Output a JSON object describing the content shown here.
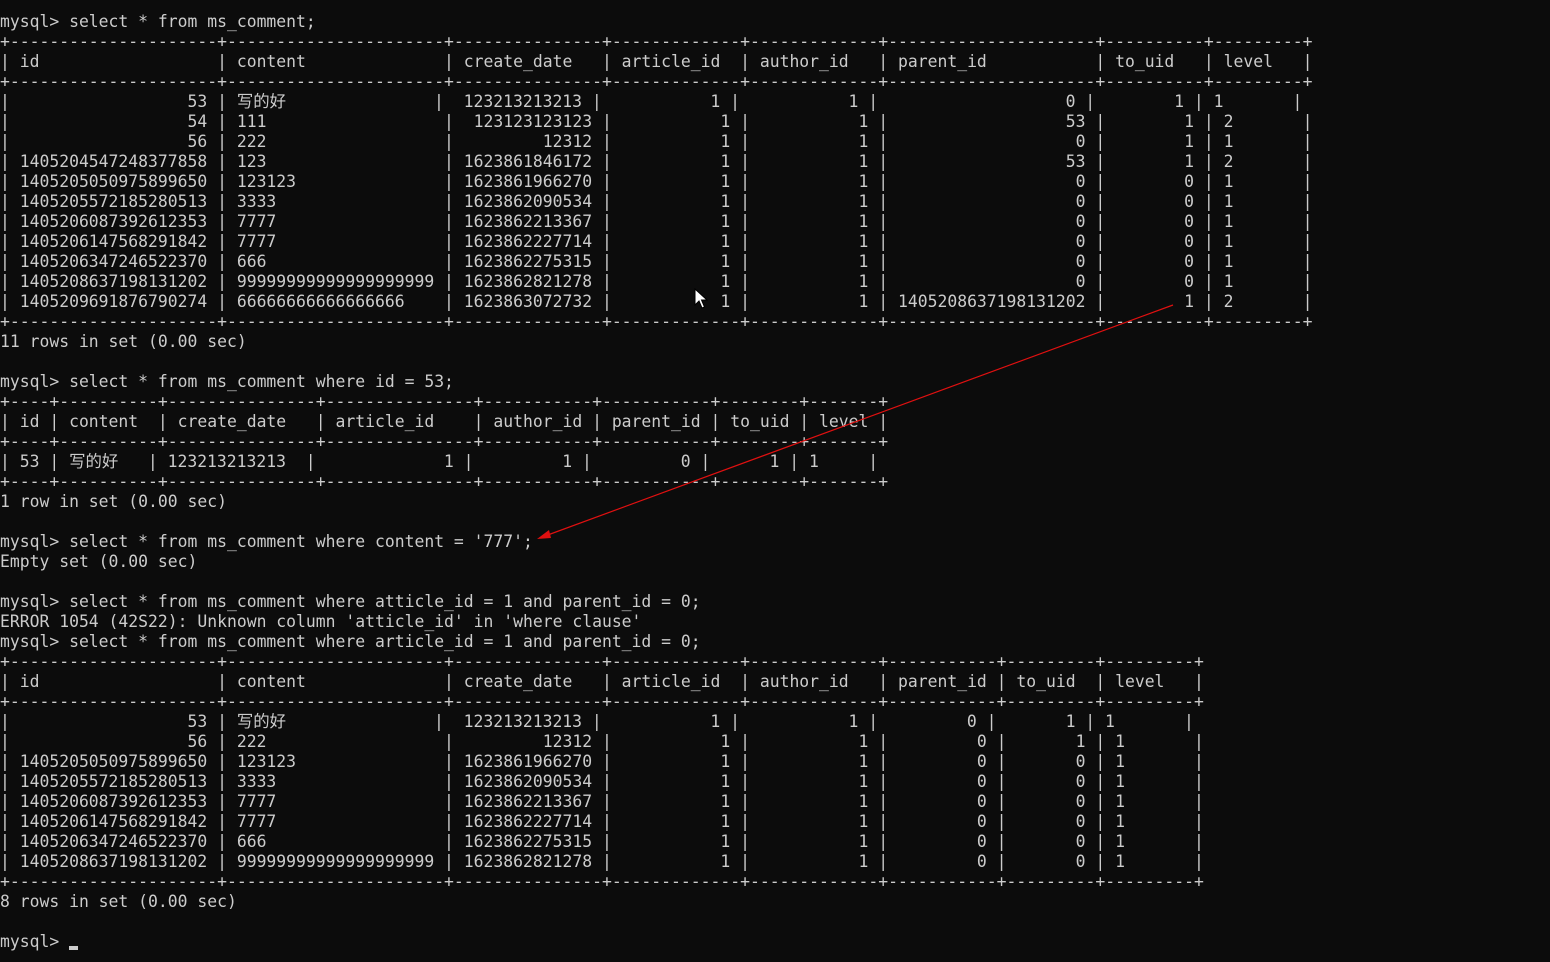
{
  "terminal": {
    "lines": [
      "mysql> select * from ms_comment;",
      "+---------------------+----------------------+---------------+-------------+-------------+---------------------+----------+---------+",
      "| id                  | content              | create_date   | article_id  | author_id   | parent_id           | to_uid   | level   |",
      "+---------------------+----------------------+---------------+-------------+-------------+---------------------+----------+---------+",
      "|                  53 | 写的好               |  123213213213 |           1 |           1 |                   0 |        1 | 1       |",
      "|                  54 | 111                  |  123123123123 |           1 |           1 |                  53 |        1 | 2       |",
      "|                  56 | 222                  |         12312 |           1 |           1 |                   0 |        1 | 1       |",
      "| 1405204547248377858 | 123                  | 1623861846172 |           1 |           1 |                  53 |        1 | 2       |",
      "| 1405205050975899650 | 123123               | 1623861966270 |           1 |           1 |                   0 |        0 | 1       |",
      "| 1405205572185280513 | 3333                 | 1623862090534 |           1 |           1 |                   0 |        0 | 1       |",
      "| 1405206087392612353 | 7777                 | 1623862213367 |           1 |           1 |                   0 |        0 | 1       |",
      "| 1405206147568291842 | 7777                 | 1623862227714 |           1 |           1 |                   0 |        0 | 1       |",
      "| 1405206347246522370 | 666                  | 1623862275315 |           1 |           1 |                   0 |        0 | 1       |",
      "| 1405208637198131202 | 99999999999999999999 | 1623862821278 |           1 |           1 |                   0 |        0 | 1       |",
      "| 1405209691876790274 | 66666666666666666    | 1623863072732 |           1 |           1 | 1405208637198131202 |        1 | 2       |",
      "+---------------------+----------------------+---------------+-------------+-------------+---------------------+----------+---------+",
      "11 rows in set (0.00 sec)",
      "",
      "mysql> select * from ms_comment where id = 53;",
      "+----+----------+---------------+---------------+-----------+-----------+--------+-------+",
      "| id | content  | create_date   | article_id    | author_id | parent_id | to_uid | level |",
      "+----+----------+---------------+---------------+-----------+-----------+--------+-------+",
      "| 53 | 写的好   | 123213213213  |             1 |         1 |         0 |      1 | 1     |",
      "+----+----------+---------------+---------------+-----------+-----------+--------+-------+",
      "1 row in set (0.00 sec)",
      "",
      "mysql> select * from ms_comment where content = '777';",
      "Empty set (0.00 sec)",
      "",
      "mysql> select * from ms_comment where atticle_id = 1 and parent_id = 0;",
      "ERROR 1054 (42S22): Unknown column 'atticle_id' in 'where clause'",
      "mysql> select * from ms_comment where article_id = 1 and parent_id = 0;",
      "+---------------------+----------------------+---------------+-------------+-------------+-----------+---------+---------+",
      "| id                  | content              | create_date   | article_id  | author_id   | parent_id | to_uid  | level   |",
      "+---------------------+----------------------+---------------+-------------+-------------+-----------+---------+---------+",
      "|                  53 | 写的好               |  123213213213 |           1 |           1 |         0 |       1 | 1       |",
      "|                  56 | 222                  |         12312 |           1 |           1 |         0 |       1 | 1       |",
      "| 1405205050975899650 | 123123               | 1623861966270 |           1 |           1 |         0 |       0 | 1       |",
      "| 1405205572185280513 | 3333                 | 1623862090534 |           1 |           1 |         0 |       0 | 1       |",
      "| 1405206087392612353 | 7777                 | 1623862213367 |           1 |           1 |         0 |       0 | 1       |",
      "| 1405206147568291842 | 7777                 | 1623862227714 |           1 |           1 |         0 |       0 | 1       |",
      "| 1405206347246522370 | 666                  | 1623862275315 |           1 |           1 |         0 |       0 | 1       |",
      "| 1405208637198131202 | 99999999999999999999 | 1623862821278 |           1 |           1 |         0 |       0 | 1       |",
      "+---------------------+----------------------+---------------+-------------+-------------+-----------+---------+---------+",
      "8 rows in set (0.00 sec)",
      "",
      "mysql> "
    ]
  },
  "colors": {
    "background": "#0c0c0c",
    "text": "#cccccc",
    "annotation_arrow": "#e01010"
  },
  "icons": {
    "mouse_pointer": "mouse-pointer-icon",
    "text_cursor": "text-cursor-icon",
    "annotation": "red-arrow-annotation"
  }
}
